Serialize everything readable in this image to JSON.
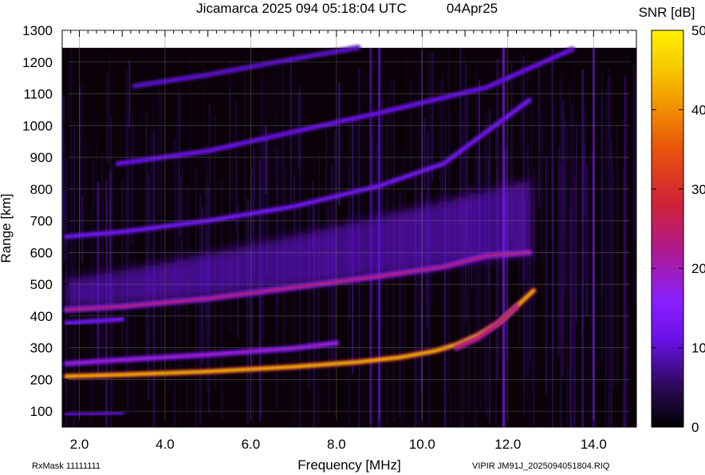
{
  "chart_data": {
    "type": "heatmap",
    "title": "Jicamarca 2025 094 05:18:04 UTC",
    "date_label": "04Apr25",
    "xlabel": "Frequency [MHz]",
    "ylabel": "Range [km]",
    "colorbar_label": "SNR [dB]",
    "xlim": [
      1.6,
      15.0
    ],
    "ylim": [
      50,
      1300
    ],
    "x_ticks": [
      2.0,
      4.0,
      6.0,
      8.0,
      10.0,
      12.0,
      14.0
    ],
    "x_tick_labels": [
      "2.0",
      "4.0",
      "6.0",
      "8.0",
      "10.0",
      "12.0",
      "14.0"
    ],
    "y_ticks": [
      100,
      200,
      300,
      400,
      500,
      600,
      700,
      800,
      900,
      1000,
      1100,
      1200,
      1300
    ],
    "y_tick_labels": [
      "100",
      "200",
      "300",
      "400",
      "500",
      "600",
      "700",
      "800",
      "900",
      "1000",
      "1100",
      "1200",
      "1300"
    ],
    "colorbar_range": [
      0,
      50
    ],
    "colorbar_ticks": [
      0,
      10,
      20,
      30,
      40,
      50
    ],
    "colorbar_tick_labels": [
      "0",
      "10",
      "20",
      "30",
      "40",
      "50"
    ],
    "grid": true,
    "data_range_top": 1245,
    "traces": [
      {
        "x": [
          1.7,
          3.0,
          5.0,
          7.0,
          8.5,
          9.5,
          10.3,
          10.8,
          11.3,
          11.8,
          12.2,
          12.6
        ],
        "y": [
          210,
          215,
          225,
          240,
          255,
          270,
          290,
          310,
          340,
          380,
          430,
          480
        ],
        "snr": 42
      },
      {
        "x": [
          10.8,
          11.3,
          11.8,
          12.2
        ],
        "y": [
          300,
          330,
          380,
          430
        ],
        "snr": 26
      },
      {
        "x": [
          1.7,
          3.0,
          5.0,
          7.0,
          8.0
        ],
        "y": [
          250,
          262,
          278,
          298,
          315
        ],
        "snr": 18
      },
      {
        "x": [
          1.7,
          3.0,
          5.0,
          7.0,
          9.0,
          10.5,
          11.5,
          12.5
        ],
        "y": [
          420,
          430,
          455,
          490,
          525,
          555,
          590,
          600
        ],
        "snr": 22
      },
      {
        "x": [
          1.7,
          3.0,
          5.0,
          7.0,
          9.0,
          10.5,
          11.5,
          12.5
        ],
        "y": [
          650,
          665,
          700,
          745,
          810,
          880,
          980,
          1080
        ],
        "snr": 12
      },
      {
        "x": [
          2.9,
          5.0,
          7.0,
          9.0,
          11.5,
          13.5
        ],
        "y": [
          880,
          920,
          980,
          1040,
          1120,
          1240
        ],
        "snr": 11
      },
      {
        "x": [
          3.3,
          5.0,
          7.0,
          8.5
        ],
        "y": [
          1125,
          1160,
          1210,
          1245
        ],
        "snr": 10
      },
      {
        "x": [
          1.7,
          2.5,
          3.0
        ],
        "y": [
          378,
          385,
          390
        ],
        "snr": 12
      },
      {
        "x": [
          1.7,
          2.5,
          3.0
        ],
        "y": [
          90,
          92,
          95
        ],
        "snr": 9
      }
    ],
    "spread_regions": [
      {
        "x0": 1.7,
        "x1": 12.5,
        "y_base": [
          430,
          600
        ],
        "height": 180,
        "snr": 10
      }
    ],
    "vertical_lines": [
      {
        "x": 8.8,
        "snr": 9
      },
      {
        "x": 9.0,
        "snr": 11
      },
      {
        "x": 11.9,
        "snr": 14
      },
      {
        "x": 14.0,
        "snr": 9
      }
    ]
  },
  "footer": {
    "rx_mask": "RxMask 11111111",
    "file_label": "VIPIR  JM91J_2025094051804.RIQ"
  },
  "colors": {
    "background": "#000000",
    "noise_dark": "#1a0818",
    "colormap": [
      "#000000",
      "#2a0a55",
      "#5b14c9",
      "#8a1fff",
      "#b01a8a",
      "#d0213a",
      "#e8520a",
      "#f39a00",
      "#f7d000",
      "#fff000"
    ]
  }
}
